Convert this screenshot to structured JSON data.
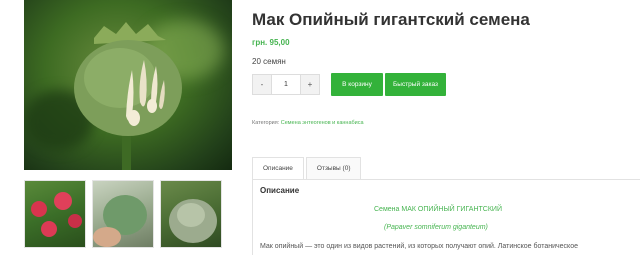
{
  "product": {
    "title": "Мак Опийный гигантский семена",
    "price": "грн. 95,00",
    "seed_count": "20 семян"
  },
  "quantity": {
    "minus": "-",
    "value": "1",
    "plus": "+"
  },
  "buttons": {
    "add_to_cart": "В корзину",
    "quick_order": "Быстрый заказ"
  },
  "category": {
    "label": "Категория:",
    "link": "Семена энтеогенов и каннабиса"
  },
  "tabs": [
    {
      "label": "Описание"
    },
    {
      "label": "Отзывы  (0)"
    }
  ],
  "description": {
    "heading": "Описание",
    "green_line_1": "Семена МАК ОПИЙНЫЙ ГИГАНТСКИЙ",
    "green_line_2": "(Papaver somniferum giganteum)",
    "body_text": "Мак опийный — это один из видов растений, из которых получают опий. Латинское ботаническое"
  },
  "colors": {
    "accent_green": "#33b23a",
    "link_green": "#46b450"
  }
}
